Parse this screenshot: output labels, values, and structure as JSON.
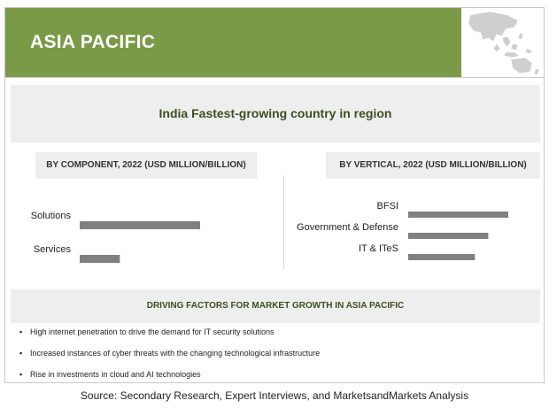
{
  "header": {
    "title": "ASIA PACIFIC",
    "band_color": "#7a9a47",
    "map_icon": "asia-pacific-map-icon"
  },
  "banner": {
    "text": "India Fastest-growing country in region"
  },
  "component_chart": {
    "heading": "BY COMPONENT, 2022 (USD MILLION/BILLION)"
  },
  "vertical_chart": {
    "heading": "BY VERTICAL, 2022 (USD MILLION/BILLION)"
  },
  "chart_data": [
    {
      "type": "bar",
      "orientation": "horizontal",
      "title": "BY COMPONENT, 2022 (USD MILLION/BILLION)",
      "categories": [
        "Solutions",
        "Services"
      ],
      "values": [
        3,
        1
      ],
      "bar_color": "#808080",
      "grid": false
    },
    {
      "type": "bar",
      "orientation": "horizontal",
      "title": "BY VERTICAL, 2022 (USD MILLION/BILLION)",
      "categories": [
        "BFSI",
        "Government & Defense",
        "IT & ITeS"
      ],
      "values": [
        3,
        2.4,
        2
      ],
      "bar_color": "#808080",
      "grid": false
    }
  ],
  "factors": {
    "heading": "DRIVING FACTORS FOR MARKET GROWTH IN ASIA PACIFIC",
    "bullet": "▪",
    "items": [
      "High internet penetration to drive the demand for IT security solutions",
      "Increased instances of cyber threats with the changing technological infrastructure",
      "Rise in investments in cloud and AI technologies"
    ]
  },
  "source": "Source: Secondary Research, Expert Interviews, and MarketsandMarkets Analysis"
}
